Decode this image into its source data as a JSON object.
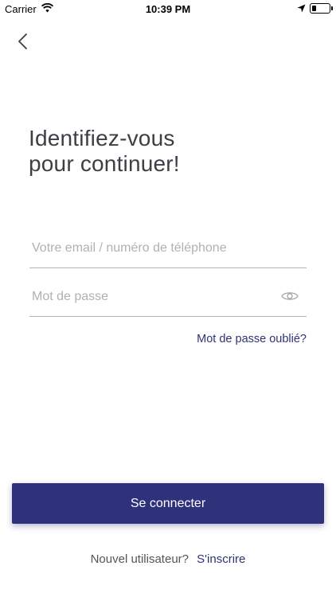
{
  "status_bar": {
    "carrier": "Carrier",
    "time": "10:39 PM",
    "battery_level": 0.25,
    "icons": [
      "wifi-icon",
      "location-arrow-icon",
      "battery-icon"
    ]
  },
  "nav": {
    "back_icon": "chevron-left-icon"
  },
  "heading": {
    "line1": "Identifiez-vous",
    "line2": "pour continuer!"
  },
  "form": {
    "email_placeholder": "Votre email / numéro de téléphone",
    "email_value": "",
    "password_placeholder": "Mot de passe",
    "password_value": "",
    "eye_icon": "eye-icon",
    "forgot_label": "Mot de passe oublié?"
  },
  "actions": {
    "connect_label": "Se connecter"
  },
  "footer": {
    "new_user_text": "Nouvel utilisateur?",
    "signup_label": "S'inscrire"
  },
  "colors": {
    "primary": "#2e327a",
    "link": "#2d3375",
    "heading": "#3e3e46",
    "placeholder": "#b0b0b6"
  }
}
